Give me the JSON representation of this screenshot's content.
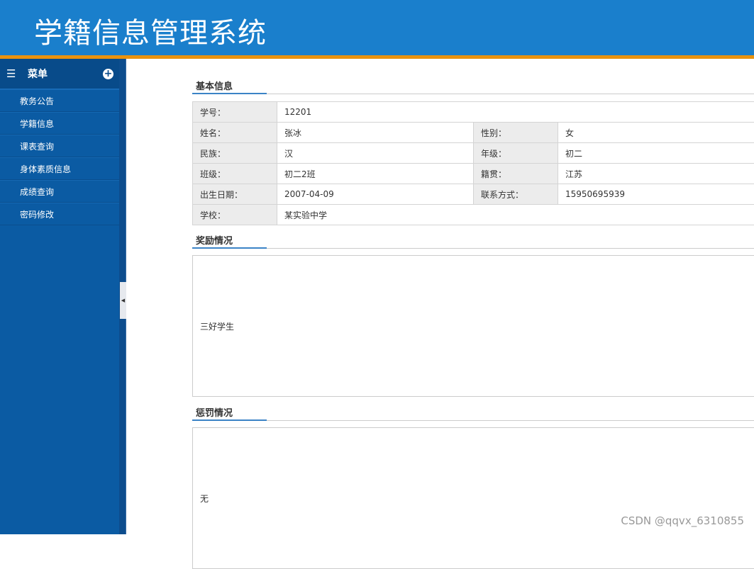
{
  "header": {
    "title": "学籍信息管理系统"
  },
  "sidebar": {
    "title": "菜单",
    "items": [
      {
        "label": "教务公告"
      },
      {
        "label": "学籍信息"
      },
      {
        "label": "课表查询"
      },
      {
        "label": "身体素质信息"
      },
      {
        "label": "成绩查询"
      },
      {
        "label": "密码修改"
      }
    ]
  },
  "basic": {
    "title": "基本信息",
    "student_id": {
      "label": "学号：",
      "value": "12201"
    },
    "name": {
      "label": "姓名：",
      "value": "张冰"
    },
    "gender": {
      "label": "性别：",
      "value": "女"
    },
    "ethnicity": {
      "label": "民族：",
      "value": "汉"
    },
    "grade": {
      "label": "年级：",
      "value": "初二"
    },
    "class": {
      "label": "班级：",
      "value": "初二2班"
    },
    "native": {
      "label": "籍贯：",
      "value": "江苏"
    },
    "birth": {
      "label": "出生日期：",
      "value": "2007-04-09"
    },
    "contact": {
      "label": "联系方式：",
      "value": "15950695939"
    },
    "school": {
      "label": "学校：",
      "value": "某实验中学"
    }
  },
  "rewards": {
    "title": "奖励情况",
    "content": "三好学生"
  },
  "punish": {
    "title": "惩罚情况",
    "content": "无"
  },
  "watermark": "CSDN @qqvx_6310855"
}
